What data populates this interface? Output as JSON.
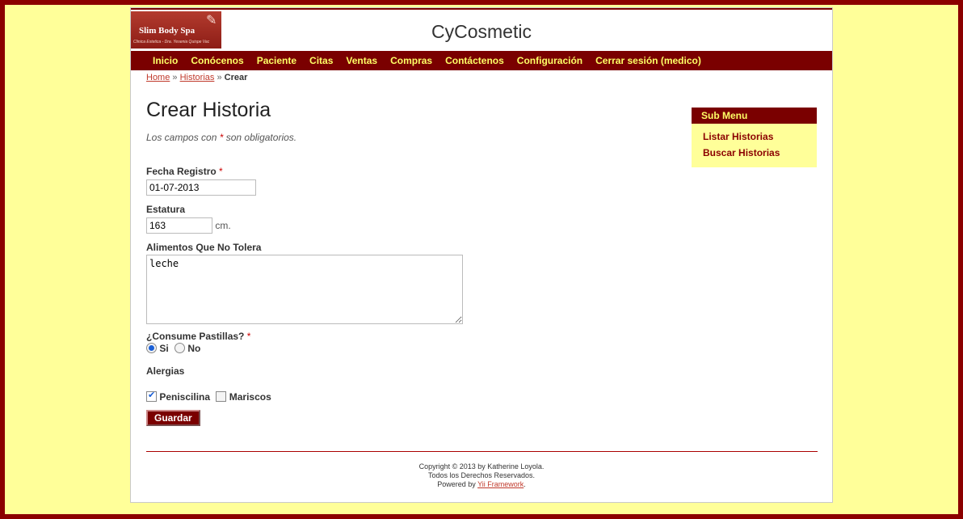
{
  "logo": {
    "title": "Slim Body Spa",
    "subtitle": "Clinica Estetica - Dra. Yesenia Quispe Vac",
    "decoration": "✎"
  },
  "site_title": "CyCosmetic",
  "menu": [
    "Inicio",
    "Conócenos",
    "Paciente",
    "Citas",
    "Ventas",
    "Compras",
    "Contáctenos",
    "Configuración",
    "Cerrar sesión (medico)"
  ],
  "breadcrumb": {
    "home": "Home",
    "separator": "»",
    "historias": "Historias",
    "current": "Crear"
  },
  "form": {
    "heading": "Crear Historia",
    "note_prefix": "Los campos con ",
    "note_star": "*",
    "note_suffix": " son obligatorios.",
    "fecha_label": "Fecha Registro",
    "fecha_value": "01-07-2013",
    "estatura_label": "Estatura",
    "estatura_value": "163",
    "estatura_unit": "cm.",
    "alimentos_label": "Alimentos Que No Tolera",
    "alimentos_value": "leche",
    "pastillas_label": "¿Consume Pastillas?",
    "pastillas_options": [
      "Si",
      "No"
    ],
    "pastillas_selected": "Si",
    "alergias_label": "Alergias",
    "alergias_options": [
      "Peniscilina",
      "Mariscos"
    ],
    "alergias_checked": [
      "Peniscilina"
    ],
    "save_label": "Guardar",
    "required_mark": "*"
  },
  "sidebar": {
    "title": "Sub Menu",
    "items": [
      "Listar Historias",
      "Buscar Historias"
    ]
  },
  "footer": {
    "line1": "Copyright © 2013 by Katherine Loyola.",
    "line2": "Todos los Derechos Reservados.",
    "line3_prefix": "Powered by ",
    "line3_link": "Yii Framework",
    "line3_suffix": "."
  },
  "colors": {
    "background": "#ffff99",
    "accent": "#7a0000",
    "menu_text": "#ffff66",
    "link": "#c0392b"
  }
}
